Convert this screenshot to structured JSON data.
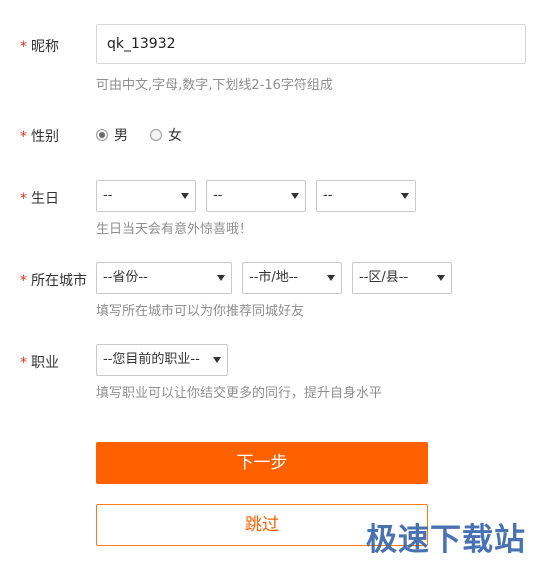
{
  "nickname": {
    "label": "昵称",
    "value": "qk_13932",
    "hint": "可由中文,字母,数字,下划线2-16字符组成"
  },
  "gender": {
    "label": "性别",
    "options": [
      "男",
      "女"
    ],
    "selected": "男"
  },
  "birthday": {
    "label": "生日",
    "year": "--",
    "month": "--",
    "day": "--",
    "hint": "生日当天会有意外惊喜哦！"
  },
  "city": {
    "label": "所在城市",
    "province": "--省份--",
    "city": "--市/地--",
    "district": "--区/县--",
    "hint": "填写所在城市可以为你推荐同城好友"
  },
  "job": {
    "label": "职业",
    "value": "--您目前的职业--",
    "hint": "填写职业可以让你结交更多的同行，提升自身水平"
  },
  "required_mark": "*",
  "buttons": {
    "next": "下一步",
    "skip": "跳过"
  },
  "watermark": "极速下载站",
  "colors": {
    "accent": "#ff6000",
    "required": "#e0341c",
    "hint": "#8f8f8f",
    "watermark": "#2f5fa8"
  },
  "icons": {
    "dropdown": "chevron-down-icon",
    "radio": "radio-icon"
  }
}
